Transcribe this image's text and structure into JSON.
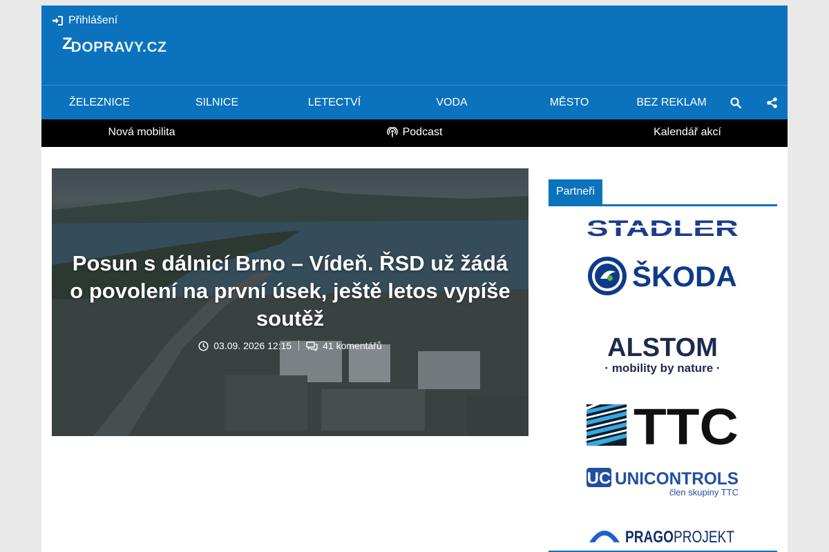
{
  "header": {
    "login_label": "Přihlášení",
    "logo_mark": "Z",
    "logo_text": "DOPRAVY.CZ"
  },
  "main_nav": {
    "items": [
      "ŽELEZNICE",
      "SILNICE",
      "LETECTVÍ",
      "VODA",
      "MĚSTO",
      "BEZ REKLAM"
    ],
    "search_icon": "search-icon",
    "share_icon": "share-icon"
  },
  "sub_nav": {
    "items": [
      "Nová mobilita",
      "Podcast",
      "Kalendář akcí"
    ],
    "podcast_icon": "podcast-icon"
  },
  "hero": {
    "title": "Posun s dálnicí Brno – Vídeň. ŘSD už žádá o povolení na první úsek, ještě letos vypíše soutěž",
    "datetime": "03.09. 2026 12:15",
    "comments": "41 komentářů"
  },
  "sidebar": {
    "heading": "Partneři",
    "partners": {
      "stadler": "STADLER",
      "skoda": "ŠKODA",
      "alstom_name": "ALSTOM",
      "alstom_tagline": "· mobility by nature ·",
      "ttc": "TTC",
      "uc_mark": "UC",
      "unicontrols": "UNICONTROLS",
      "unicontrols_sub": "člen skupiny TTC",
      "prago_bold": "PRAGO",
      "prago_rest": "PROJEKT"
    }
  },
  "colors": {
    "brand_blue": "#0b72bd",
    "subnav_bg": "#000000",
    "stadler": "#1c3c8c",
    "skoda": "#0e3a8a",
    "ttc": "#111111",
    "unicontrols": "#1f4fa0"
  }
}
